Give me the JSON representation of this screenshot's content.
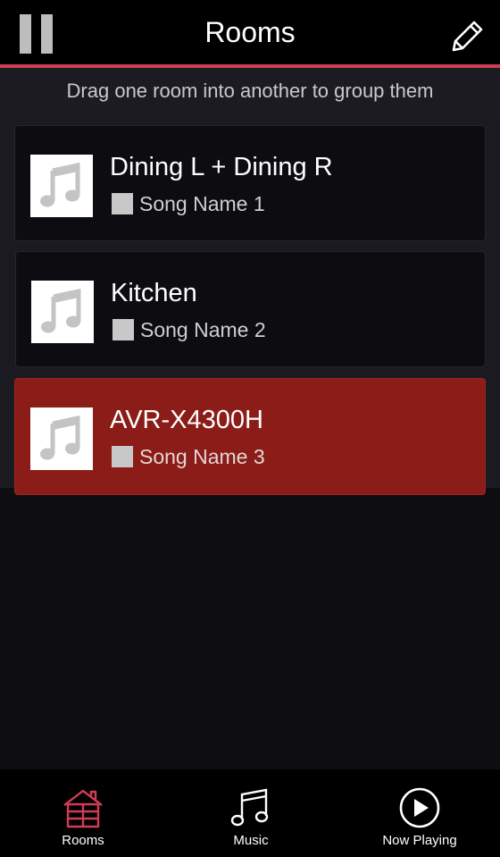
{
  "header": {
    "title": "Rooms",
    "left_icon": "pause-icon",
    "right_icon": "pencil-icon"
  },
  "hint": "Drag one room into another to group them",
  "rooms": [
    {
      "name": "Dining L + Dining R",
      "song": "Song Name 1",
      "selected": false
    },
    {
      "name": "Kitchen",
      "song": "Song Name 2",
      "selected": false
    },
    {
      "name": "AVR-X4300H",
      "song": "Song Name 3",
      "selected": true
    }
  ],
  "nav": [
    {
      "label": "Rooms",
      "icon": "house-icon",
      "active": true
    },
    {
      "label": "Music",
      "icon": "music-notes-icon",
      "active": false
    },
    {
      "label": "Now Playing",
      "icon": "play-circle-icon",
      "active": false
    }
  ],
  "colors": {
    "accent": "#cf3c55",
    "selected_room": "#8b1c17",
    "header_bg": "#000000",
    "hint_bg": "#1c1b22"
  }
}
